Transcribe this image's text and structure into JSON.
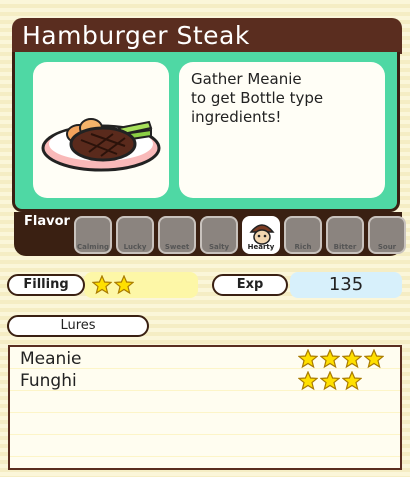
{
  "recipe": {
    "title": "Hamburger Steak",
    "description": "Gather Meanie\nto get Bottle type\ningredients!"
  },
  "flavor": {
    "label": "Flavor",
    "icons": [
      {
        "name": "Calming",
        "active": false
      },
      {
        "name": "Lucky",
        "active": false
      },
      {
        "name": "Sweet",
        "active": false
      },
      {
        "name": "Salty",
        "active": false
      },
      {
        "name": "Hearty",
        "active": true
      },
      {
        "name": "Rich",
        "active": false
      },
      {
        "name": "Bitter",
        "active": false
      },
      {
        "name": "Sour",
        "active": false
      }
    ]
  },
  "filling": {
    "label": "Filling",
    "stars": 2
  },
  "exp": {
    "label": "Exp",
    "value": "135"
  },
  "lures": {
    "label": "Lures",
    "items": [
      {
        "name": "Meanie",
        "stars": 4
      },
      {
        "name": "Funghi",
        "stars": 3
      }
    ]
  },
  "colors": {
    "accent": "#4fd8a4",
    "frame": "#3a2012",
    "title_bg": "#5a2d1f",
    "star": "#ffe000"
  }
}
